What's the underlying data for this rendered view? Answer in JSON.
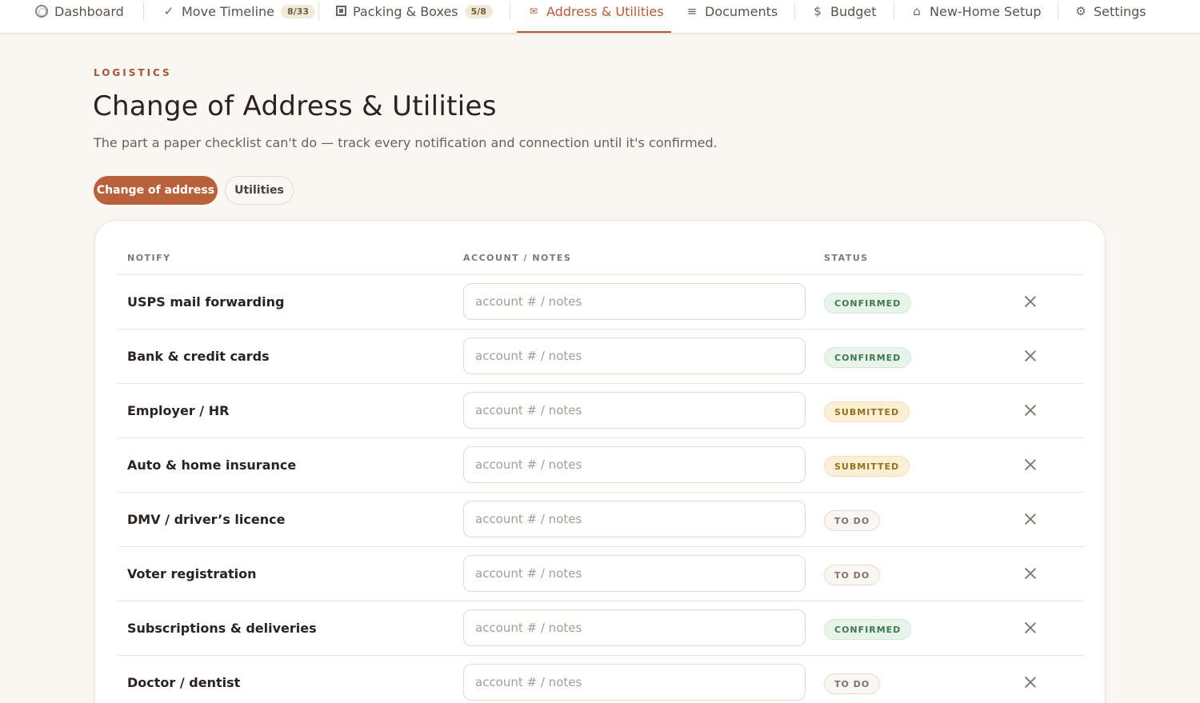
{
  "nav": {
    "items": [
      {
        "label": "Dashboard",
        "icon": "circle-icon"
      },
      {
        "label": "Move Timeline",
        "icon": "check-icon",
        "badge": "8/33"
      },
      {
        "label": "Packing & Boxes",
        "icon": "box-icon",
        "badge": "5/8"
      },
      {
        "label": "Address & Utilities",
        "icon": "envelope-icon",
        "active": true
      },
      {
        "label": "Documents",
        "icon": "list-icon"
      },
      {
        "label": "Budget",
        "icon": "dollar-icon"
      },
      {
        "label": "New-Home Setup",
        "icon": "home-icon"
      },
      {
        "label": "Settings",
        "icon": "gear-icon"
      }
    ],
    "glyphs": {
      "check": "✓",
      "envelope": "✉",
      "list": "≡",
      "dollar": "$",
      "home": "⌂",
      "gear": "⚙"
    }
  },
  "header": {
    "eyebrow": "LOGISTICS",
    "title": "Change of Address & Utilities",
    "subtitle": "The part a paper checklist can't do — track every notification and connection until it's confirmed."
  },
  "tabs": [
    {
      "label": "Change of address",
      "active": true
    },
    {
      "label": "Utilities",
      "active": false
    }
  ],
  "table": {
    "columns": [
      "NOTIFY",
      "ACCOUNT / NOTES",
      "STATUS"
    ],
    "input_placeholder": "account # / notes",
    "rows": [
      {
        "name": "USPS mail forwarding",
        "status": "CONFIRMED"
      },
      {
        "name": "Bank & credit cards",
        "status": "CONFIRMED"
      },
      {
        "name": "Employer / HR",
        "status": "SUBMITTED"
      },
      {
        "name": "Auto & home insurance",
        "status": "SUBMITTED"
      },
      {
        "name": "DMV / driver’s licence",
        "status": "TO DO"
      },
      {
        "name": "Voter registration",
        "status": "TO DO"
      },
      {
        "name": "Subscriptions & deliveries",
        "status": "CONFIRMED"
      },
      {
        "name": "Doctor / dentist",
        "status": "TO DO"
      }
    ]
  },
  "colors": {
    "accent": "#b9613a",
    "background": "#faf6f1",
    "confirmed": "#3b7a4c",
    "submitted": "#96701b",
    "todo": "#7d746c"
  }
}
